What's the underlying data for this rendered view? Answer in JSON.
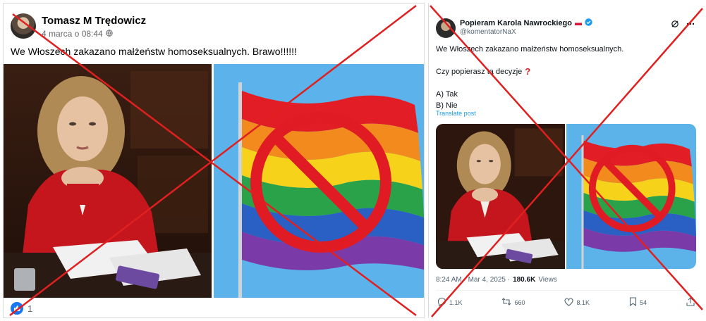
{
  "left_post": {
    "author": "Tomasz M Trędowicz",
    "date": "4 marca o 08:44",
    "text": "We Włoszech zakazano małżeństw homoseksualnych. Brawo!!!!!!",
    "reaction_count": "1",
    "icons": {
      "visibility": "globe-icon",
      "reaction": "like-icon"
    }
  },
  "right_post": {
    "author": "Popieram Karola Nawrockiego",
    "handle": "@komentatorNaX",
    "line1": "We Włoszech zakazano małżeństw homoseksualnych.",
    "line2": "Czy popierasz tą decyzje",
    "option_a": "A) Tak",
    "option_b": "B) Nie",
    "translate": "Translate post",
    "timestamp": "8:24 AM · Mar 4, 2025 ·",
    "views_count": "180.6K",
    "views_label": "Views",
    "replies": "1.1K",
    "reposts": "660",
    "likes": "8.1K",
    "bookmarks": "54"
  },
  "colors": {
    "facebook_blue": "#1877f2",
    "x_blue": "#1d9bf0",
    "cross_red": "#e02020",
    "prohibition_red": "#e01b24"
  }
}
